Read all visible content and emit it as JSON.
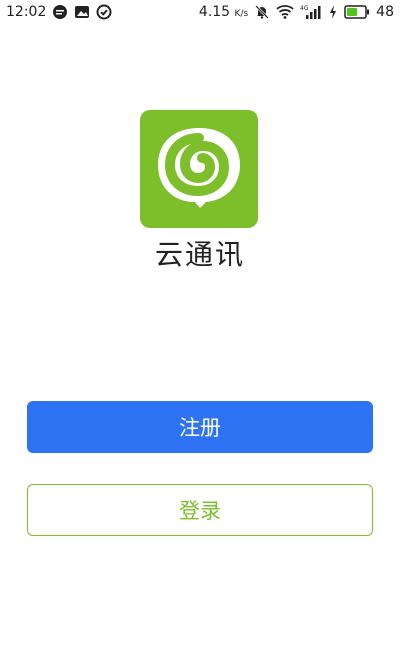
{
  "status_bar": {
    "time": "12:02",
    "speed": "4.15",
    "speed_unit": "K/s",
    "network_type": "4G",
    "battery": "48",
    "icons_left": [
      "message-icon",
      "image-notification-icon",
      "check-circle-icon"
    ],
    "icons_right": [
      "muted-bell-icon",
      "wifi-icon",
      "signal-icon",
      "charging-icon",
      "battery-icon"
    ]
  },
  "app": {
    "brand_name": "云通讯",
    "logo_color": "#7cbf2a"
  },
  "actions": {
    "register_label": "注册",
    "login_label": "登录",
    "register_color": "#2f73f5",
    "login_color": "#7cbf2a"
  }
}
